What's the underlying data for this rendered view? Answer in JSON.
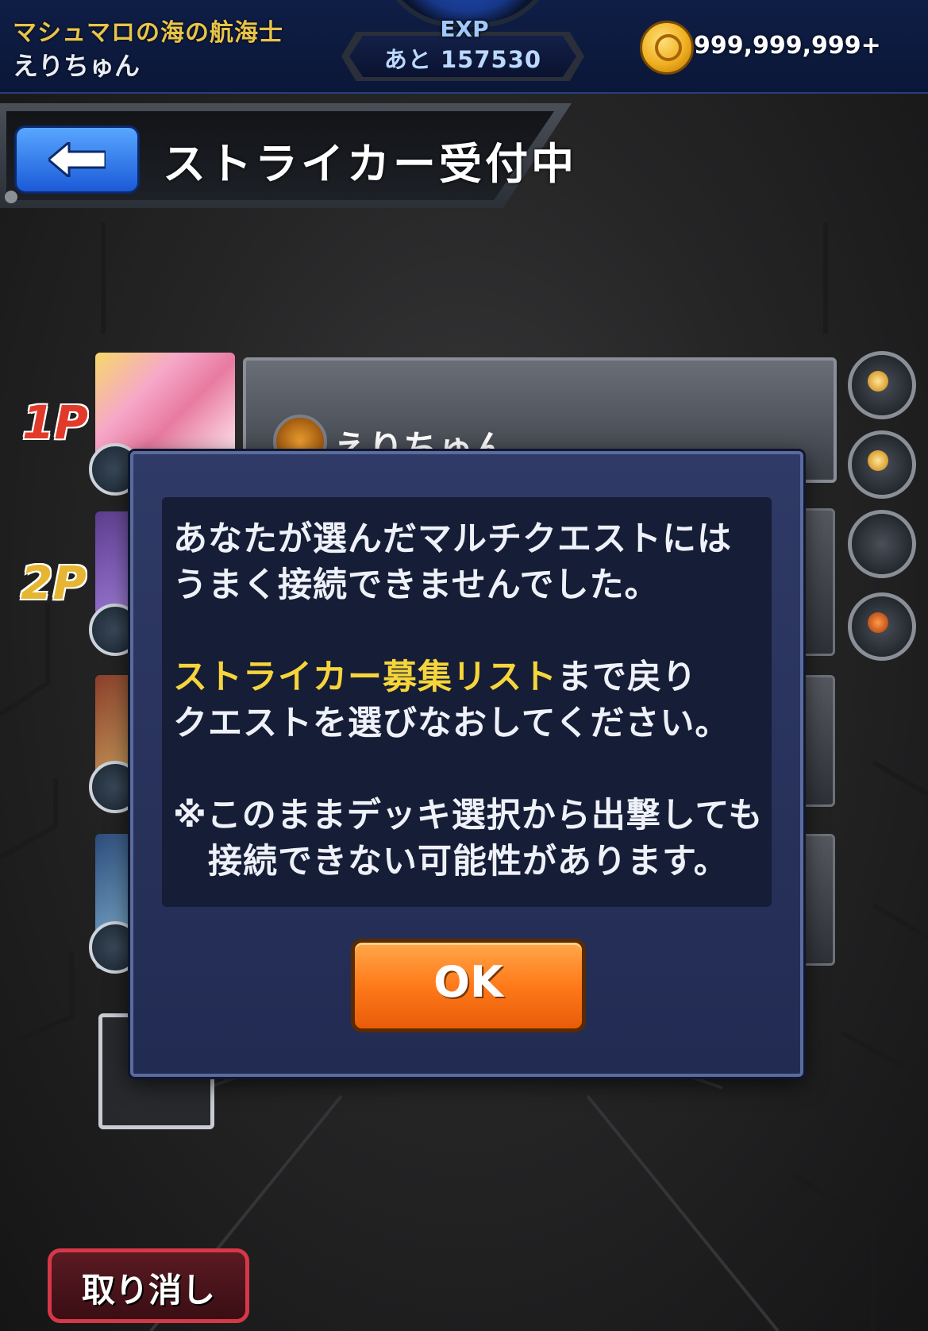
{
  "top_bar": {
    "rank_title": "マシュマロの海の航海士",
    "player_name": "えりちゅん",
    "exp_label": "EXP",
    "exp_remaining": "あと 157530",
    "coins": "999,999,999+"
  },
  "header": {
    "title": "ストライカー受付中"
  },
  "slots": {
    "p1_label": "1P",
    "p2_label": "2P",
    "p1_name": "えりちゅん"
  },
  "dialog": {
    "line1": "あなたが選んだマルチクエストには",
    "line2": "うまく接続できませんでした。",
    "line3_highlight": "ストライカー募集リスト",
    "line3_rest": "まで戻り",
    "line4": "クエストを選びなおしてください。",
    "line5": "※このままデッキ選択から出撃しても",
    "line6": "接続できない可能性があります。",
    "ok_label": "OK"
  },
  "footer": {
    "cancel_label": "取り消し"
  },
  "colors": {
    "highlight_text": "#f5d53b",
    "ok_button": "#ff7a1a",
    "back_button": "#1b5ad8",
    "cancel_border": "#d63848"
  }
}
